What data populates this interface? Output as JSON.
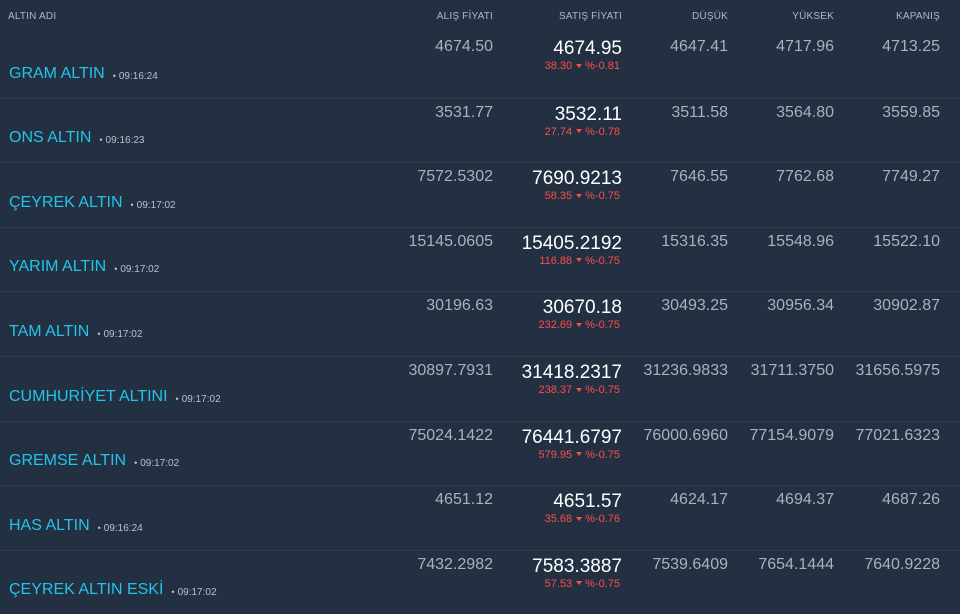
{
  "columns": {
    "name": "ALTIN ADI",
    "buy": "ALIŞ FİYATI",
    "sell": "SATIŞ FİYATI",
    "low": "DÜŞÜK",
    "high": "YÜKSEK",
    "close": "KAPANIŞ"
  },
  "rows": [
    {
      "name": "GRAM ALTIN",
      "time": "09:16:24",
      "buy": "4674.50",
      "sell": "4674.95",
      "change": "38.30",
      "change_pct": "%-0.81",
      "low": "4647.41",
      "high": "4717.96",
      "close": "4713.25"
    },
    {
      "name": "ONS ALTIN",
      "time": "09:16:23",
      "buy": "3531.77",
      "sell": "3532.11",
      "change": "27.74",
      "change_pct": "%-0.78",
      "low": "3511.58",
      "high": "3564.80",
      "close": "3559.85"
    },
    {
      "name": "ÇEYREK ALTIN",
      "time": "09:17:02",
      "buy": "7572.5302",
      "sell": "7690.9213",
      "change": "58.35",
      "change_pct": "%-0.75",
      "low": "7646.55",
      "high": "7762.68",
      "close": "7749.27"
    },
    {
      "name": "YARIM ALTIN",
      "time": "09:17:02",
      "buy": "15145.0605",
      "sell": "15405.2192",
      "change": "116.88",
      "change_pct": "%-0.75",
      "low": "15316.35",
      "high": "15548.96",
      "close": "15522.10"
    },
    {
      "name": "TAM ALTIN",
      "time": "09:17:02",
      "buy": "30196.63",
      "sell": "30670.18",
      "change": "232.69",
      "change_pct": "%-0.75",
      "low": "30493.25",
      "high": "30956.34",
      "close": "30902.87"
    },
    {
      "name": "CUMHURİYET ALTINI",
      "time": "09:17:02",
      "buy": "30897.7931",
      "sell": "31418.2317",
      "change": "238.37",
      "change_pct": "%-0.75",
      "low": "31236.9833",
      "high": "31711.3750",
      "close": "31656.5975"
    },
    {
      "name": "GREMSE ALTIN",
      "time": "09:17:02",
      "buy": "75024.1422",
      "sell": "76441.6797",
      "change": "579.95",
      "change_pct": "%-0.75",
      "low": "76000.6960",
      "high": "77154.9079",
      "close": "77021.6323"
    },
    {
      "name": "HAS ALTIN",
      "time": "09:16:24",
      "buy": "4651.12",
      "sell": "4651.57",
      "change": "35.68",
      "change_pct": "%-0.76",
      "low": "4624.17",
      "high": "4694.37",
      "close": "4687.26"
    },
    {
      "name": "ÇEYREK ALTIN ESKİ",
      "time": "09:17:02",
      "buy": "7432.2982",
      "sell": "7583.3887",
      "change": "57.53",
      "change_pct": "%-0.75",
      "low": "7539.6409",
      "high": "7654.1444",
      "close": "7640.9228"
    }
  ],
  "colors": {
    "background": "#223041",
    "name": "#25c3ea",
    "negative": "#ff4c4c",
    "muted": "#a8b2be",
    "sell": "#ffffff"
  },
  "icons": {
    "change_direction": "down-caret-icon"
  }
}
